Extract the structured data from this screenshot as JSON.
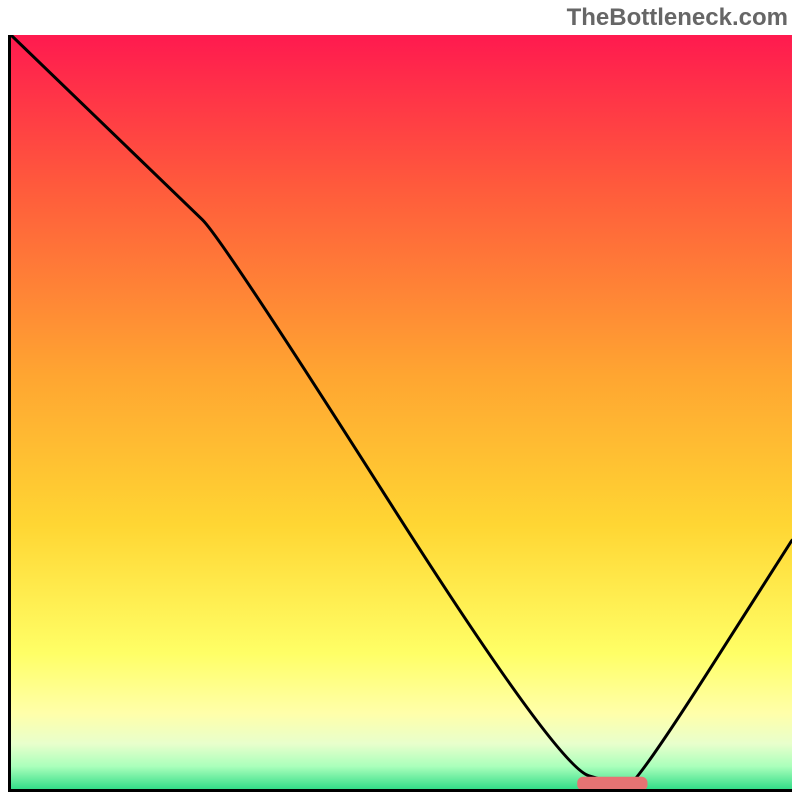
{
  "watermark": "TheBottleneck.com",
  "chart_data": {
    "type": "line",
    "title": "",
    "xlabel": "",
    "ylabel": "",
    "xlim": [
      0,
      100
    ],
    "ylim": [
      0,
      100
    ],
    "grid": false,
    "legend": false,
    "series": [
      {
        "name": "bottleneck-curve",
        "x": [
          0,
          22,
          27,
          70,
          78,
          80,
          100
        ],
        "y": [
          100,
          78,
          73,
          3,
          0.5,
          0.5,
          33
        ]
      }
    ],
    "marker": {
      "name": "optimal-range",
      "x_center": 77,
      "y": 0.7,
      "width": 9,
      "color": "#e57373"
    },
    "gradient": {
      "stops": [
        {
          "pos": 0.0,
          "color": "#ff1a4f"
        },
        {
          "pos": 0.2,
          "color": "#ff5a3c"
        },
        {
          "pos": 0.45,
          "color": "#ffa531"
        },
        {
          "pos": 0.65,
          "color": "#ffd633"
        },
        {
          "pos": 0.82,
          "color": "#ffff66"
        },
        {
          "pos": 0.9,
          "color": "#ffffaa"
        },
        {
          "pos": 0.94,
          "color": "#e8ffcc"
        },
        {
          "pos": 0.97,
          "color": "#aaffbb"
        },
        {
          "pos": 1.0,
          "color": "#33dd88"
        }
      ]
    }
  }
}
